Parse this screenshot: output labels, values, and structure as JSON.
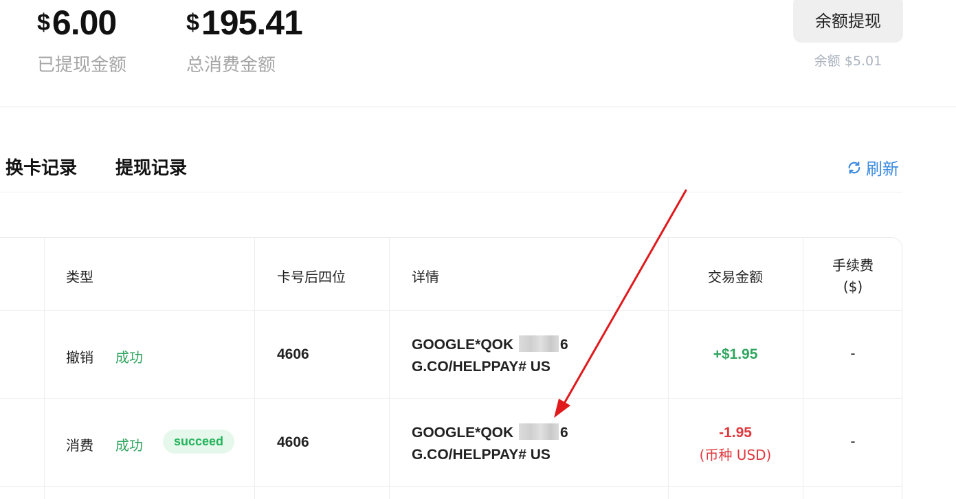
{
  "stats": {
    "withdrawn": {
      "currency": "$",
      "value": "6.00",
      "label": "已提现金额"
    },
    "total_spent": {
      "currency": "$",
      "value": "195.41",
      "label": "总消费金额"
    }
  },
  "withdraw_button": {
    "label": "余额提现",
    "balance_note": "余额 $5.01"
  },
  "tabs": [
    {
      "label": "换卡记录"
    },
    {
      "label": "提现记录"
    }
  ],
  "refresh": {
    "label": "刷新",
    "icon": "refresh-icon"
  },
  "table": {
    "headers": {
      "type": "类型",
      "card_last4": "卡号后四位",
      "details": "详情",
      "amount": "交易金额",
      "fee_line1": "手续费",
      "fee_line2": "($)"
    },
    "rows": [
      {
        "type": "撤销",
        "status": "成功",
        "badge": "",
        "card_last4": "4606",
        "detail_prefix": "GOOGLE*QOK",
        "detail_suffix": "6",
        "detail_line2": "G.CO/HELPPAY# US",
        "amount": "+$1.95",
        "amount_note": "",
        "fee": "-"
      },
      {
        "type": "消费",
        "status": "成功",
        "badge": "succeed",
        "card_last4": "4606",
        "detail_prefix": "GOOGLE*QOK",
        "detail_suffix": "6",
        "detail_line2": "G.CO/HELPPAY# US",
        "amount": "-1.95",
        "amount_note": "(币种 USD)",
        "fee": "-"
      }
    ]
  },
  "colors": {
    "accent_blue": "#3d8be0",
    "success_green": "#2fa55f",
    "negative_red": "#e0383d",
    "annotation_arrow": "#e0191c"
  }
}
